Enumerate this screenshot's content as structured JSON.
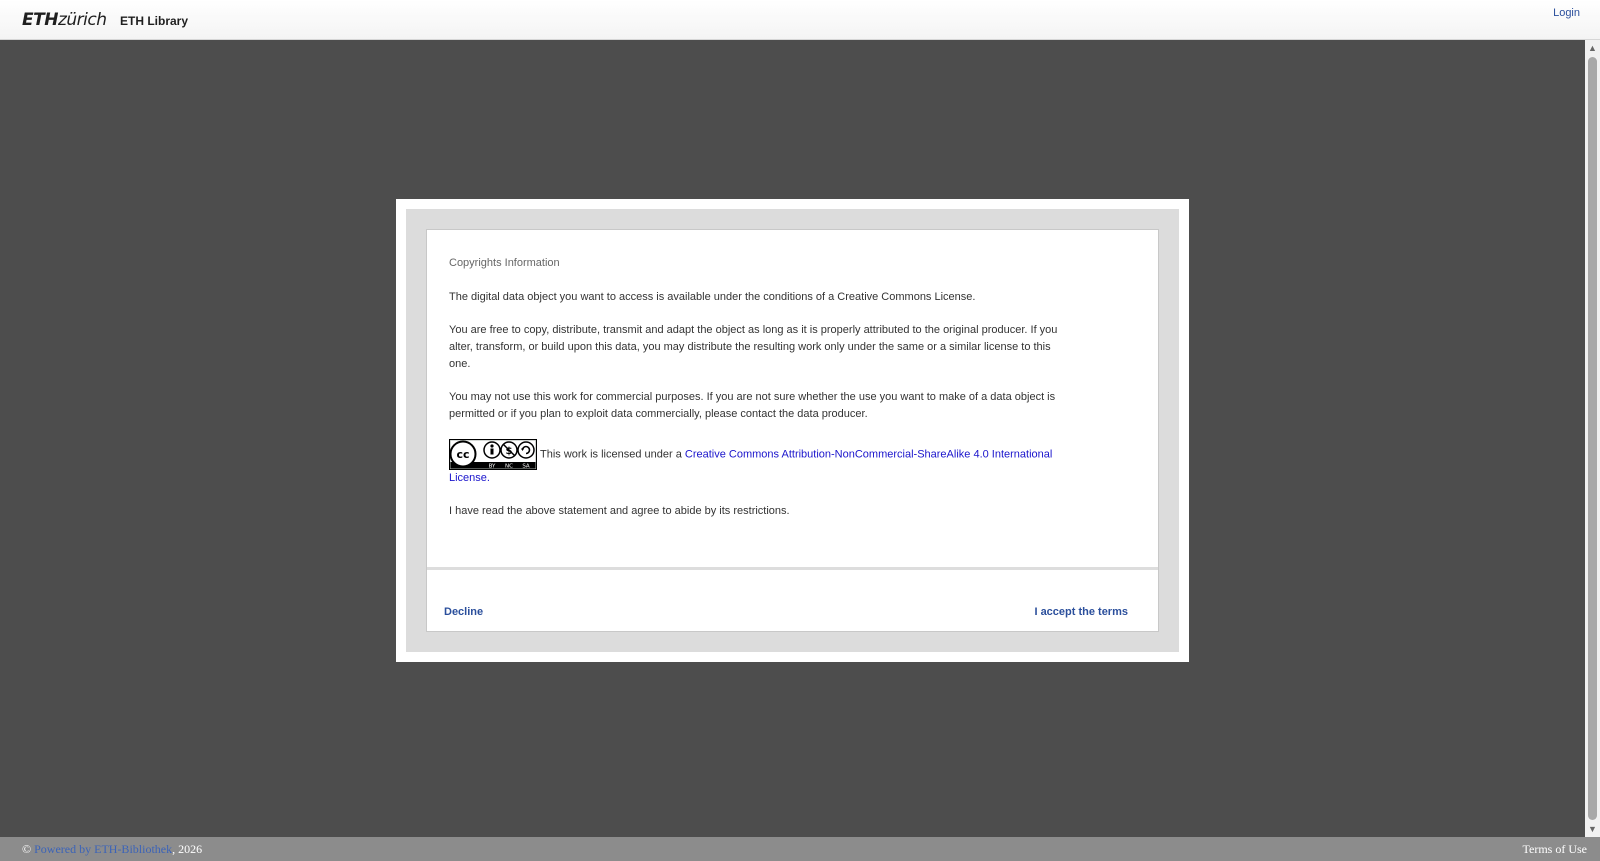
{
  "header": {
    "logo_bold": "ETH",
    "logo_light": "zürich",
    "library_name": "ETH Library",
    "login_label": "Login"
  },
  "modal": {
    "title": "Copyrights Information",
    "paragraph1": "The digital data object you want to access is available under the conditions of a Creative Commons License.",
    "paragraph2": "You are free to copy, distribute, transmit and adapt the object as long as it is properly attributed to the original producer. If you alter, transform, or build upon this data, you may distribute the resulting work only under the same or a similar license to this one.",
    "paragraph3": "You may not use this work for commercial purposes. If you are not sure whether the use you want to make of a data object is permitted or if you plan to exploit data commercially, please contact the data producer.",
    "license_prefix": "This work is licensed under a ",
    "license_link": "Creative Commons Attribution-NonCommercial-ShareAlike 4.0 International License",
    "license_suffix": ".",
    "cc_badge": {
      "cc": "cc",
      "by": "BY",
      "nc": "NC",
      "sa": "SA"
    },
    "agreement": "I have read the above statement and agree to abide by its restrictions.",
    "decline_label": "Decline",
    "accept_label": "I accept the terms"
  },
  "footer": {
    "copyright_symbol": "©",
    "powered_by": "Powered by ETH-Bibliothek",
    "year": ", 2026",
    "terms_label": "Terms of Use"
  }
}
